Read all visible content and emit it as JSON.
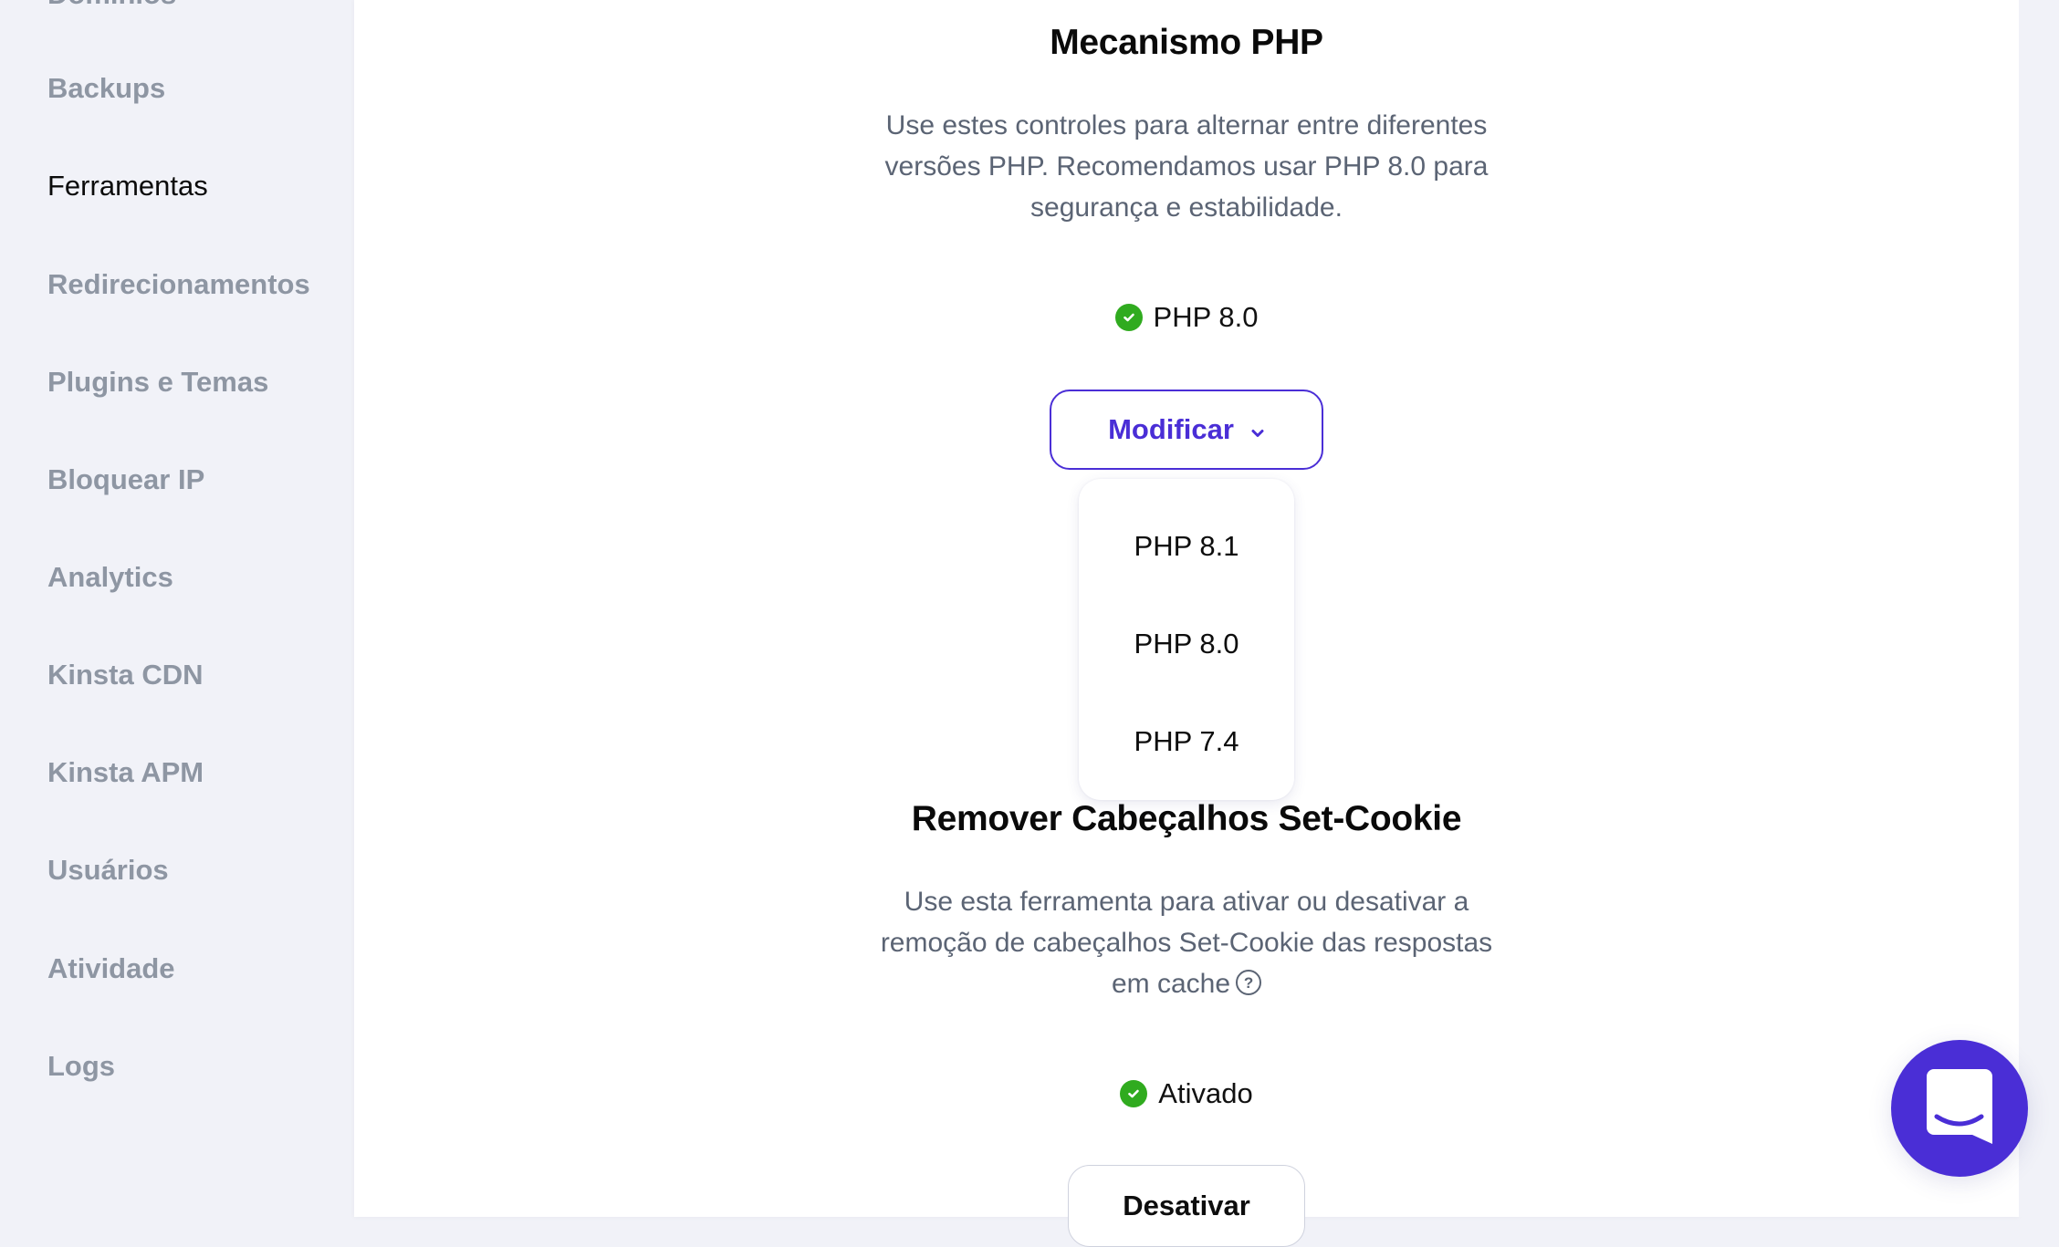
{
  "sidebar": {
    "items": [
      {
        "label": "Domínios",
        "active": false
      },
      {
        "label": "Backups",
        "active": false
      },
      {
        "label": "Ferramentas",
        "active": true
      },
      {
        "label": "Redirecionamentos",
        "active": false
      },
      {
        "label": "Plugins e Temas",
        "active": false
      },
      {
        "label": "Bloquear IP",
        "active": false
      },
      {
        "label": "Analytics",
        "active": false
      },
      {
        "label": "Kinsta CDN",
        "active": false
      },
      {
        "label": "Kinsta APM",
        "active": false
      },
      {
        "label": "Usuários",
        "active": false
      },
      {
        "label": "Atividade",
        "active": false
      },
      {
        "label": "Logs",
        "active": false
      }
    ]
  },
  "php_engine": {
    "title": "Mecanismo PHP",
    "description_lines": [
      "Use estes controles para alternar entre diferentes",
      "versões PHP. Recomendamos usar PHP 8.0 para",
      "segurança e estabilidade."
    ],
    "status_icon": "check-circle-icon",
    "status_text": "PHP 8.0",
    "modify_button_label": "Modificar",
    "dropdown_options": [
      "PHP 8.1",
      "PHP 8.0",
      "PHP 7.4"
    ]
  },
  "set_cookie": {
    "title": "Remover Cabeçalhos Set-Cookie",
    "description_lines": [
      "Use esta ferramenta para ativar ou desativar a",
      "remoção de cabeçalhos Set-Cookie das respostas",
      "em cache"
    ],
    "help_icon_glyph": "?",
    "status_icon": "check-circle-icon",
    "status_text": "Ativado",
    "disable_button_label": "Desativar"
  },
  "chat": {
    "icon": "chat-bubble-icon"
  },
  "colors": {
    "accent": "#4a2ed6",
    "success": "#30ab1f",
    "sidebar_bg": "#f1f2f8",
    "muted_text": "#8e96a3"
  }
}
